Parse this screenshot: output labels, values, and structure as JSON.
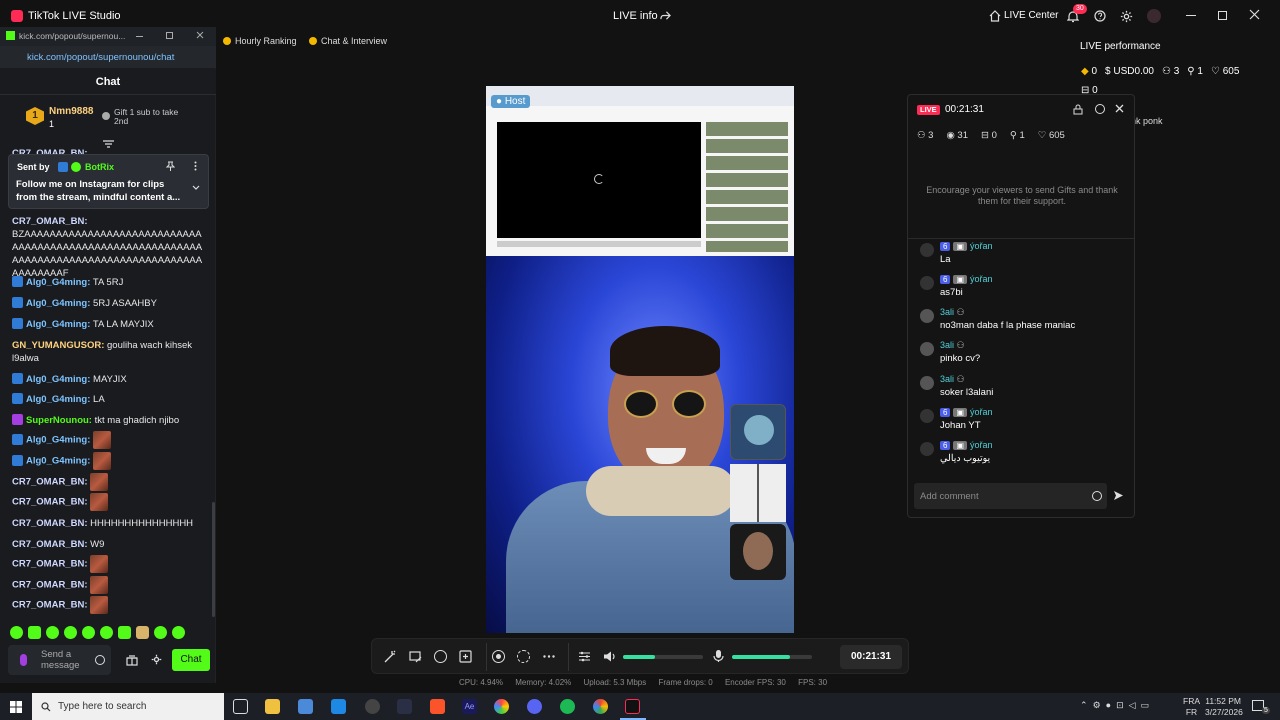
{
  "app": {
    "title": "TikTok LIVE Studio",
    "center_title": "LIVE info",
    "live_center_label": "LIVE Center",
    "notif_count": "30"
  },
  "kick": {
    "tab_title": "kick.com/popout/supernou...",
    "url": "kick.com/popout/supernounou/chat",
    "chat_header": "Chat",
    "gifter_name": "Nmn9888",
    "gifter_rank": "1",
    "gifter_count": "1",
    "gift_prompt": "Gift 1 sub to take 2nd",
    "pinned_by_label": "Sent by",
    "pinned_by_user": "BotRix",
    "pinned_text": "Follow me on Instagram for clips from the stream, mindful content a...",
    "messages": [
      {
        "user": "CR7_OMAR_BN:",
        "text": "BZAAAAAAAAAAAAAAAAAAAAAAAAAAAAAAAAAAAAAAAAAAAAAAAAAAAAAAAAAAAAAAAAAAAAAAAAAAAAAAAAAAAAAAAAAAAAAAAAF"
      },
      {
        "user": "Alg0_G4ming:",
        "text": "TA 5RJ"
      },
      {
        "user": "Alg0_G4ming:",
        "text": "5RJ ASAAHBY"
      },
      {
        "user": "Alg0_G4ming:",
        "text": "TA LA MAYJIX"
      },
      {
        "user": "GN_YUMANGUSOR:",
        "text": "gouliha wach kihsek l9alwa"
      },
      {
        "user": "Alg0_G4ming:",
        "text": "MAYJIX"
      },
      {
        "user": "Alg0_G4ming:",
        "text": "LA"
      },
      {
        "user": "SuperNounou:",
        "text": "tkt ma ghadich njibo"
      },
      {
        "user": "Alg0_G4ming:",
        "text": ""
      },
      {
        "user": "Alg0_G4ming:",
        "text": ""
      },
      {
        "user": "CR7_OMAR_BN:",
        "text": ""
      },
      {
        "user": "CR7_OMAR_BN:",
        "text": ""
      },
      {
        "user": "CR7_OMAR_BN:",
        "text": "HHHHHHHHHHHHHHH"
      },
      {
        "user": "CR7_OMAR_BN:",
        "text": "W9"
      },
      {
        "user": "CR7_OMAR_BN:",
        "text": ""
      },
      {
        "user": "CR7_OMAR_BN:",
        "text": ""
      },
      {
        "user": "CR7_OMAR_BN:",
        "text": ""
      }
    ],
    "send_placeholder": "Send a message",
    "chat_button": "Chat"
  },
  "toolbar": {
    "hourly_ranking": "Hourly Ranking",
    "chat_interview": "Chat & Interview"
  },
  "stage": {
    "host_label": "Host"
  },
  "performance": {
    "title": "LIVE performance",
    "diamonds": "0",
    "usd": "USD0.00",
    "viewers": "3",
    "new_followers": "1",
    "likes": "605",
    "gifters": "0",
    "pinned_user": "Pink ponk"
  },
  "live_panel": {
    "live_badge": "LIVE",
    "timer": "00:21:31",
    "viewers": "3",
    "views": "31",
    "gifts": "0",
    "follows": "1",
    "likes": "605",
    "encourage": "Encourage your viewers to send Gifts and thank them for their support.",
    "comments": [
      {
        "name": "ýořan",
        "level": "6",
        "text": "La"
      },
      {
        "name": "ýořan",
        "level": "6",
        "text": "as7bi"
      },
      {
        "name": "3ali",
        "level": "",
        "text": "no3man daba f la phase maniac"
      },
      {
        "name": "3ali",
        "level": "",
        "text": "pinko cv?"
      },
      {
        "name": "3ali",
        "level": "",
        "text": "soker l3alani"
      },
      {
        "name": "ýořan",
        "level": "6",
        "text": "Johan YT"
      },
      {
        "name": "ýořan",
        "level": "6",
        "text": "يوتيوب ديالي"
      }
    ],
    "add_comment_placeholder": "Add comment"
  },
  "controls": {
    "timer": "00:21:31",
    "speaker_level": 0.4,
    "mic_level": 0.72
  },
  "stats": {
    "cpu": "CPU:  4.94%",
    "memory": "Memory:  4.02%",
    "upload": "Upload:  5.3 Mbps",
    "frame_drops": "Frame drops:  0",
    "encoder_fps": "Encoder FPS:  30",
    "fps": "FPS:  30"
  },
  "taskbar": {
    "search_placeholder": "Type here to search",
    "lang_top": "FRA",
    "lang_bottom": "FR",
    "time": "11:52 PM",
    "date": "3/27/2026",
    "notif": "5"
  },
  "colors": {
    "accent_pink": "#fe2c55",
    "kick_green": "#53fc18",
    "level_green": "#2ecc71"
  }
}
